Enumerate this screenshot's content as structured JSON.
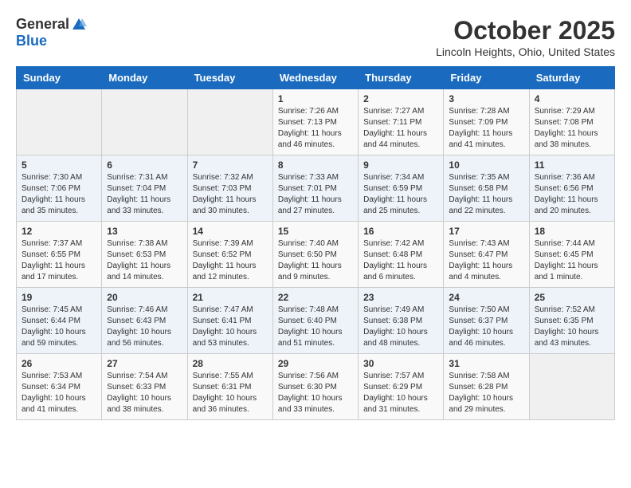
{
  "header": {
    "logo_general": "General",
    "logo_blue": "Blue",
    "month_title": "October 2025",
    "location": "Lincoln Heights, Ohio, United States"
  },
  "days_of_week": [
    "Sunday",
    "Monday",
    "Tuesday",
    "Wednesday",
    "Thursday",
    "Friday",
    "Saturday"
  ],
  "weeks": [
    [
      {
        "day": "",
        "info": ""
      },
      {
        "day": "",
        "info": ""
      },
      {
        "day": "",
        "info": ""
      },
      {
        "day": "1",
        "info": "Sunrise: 7:26 AM\nSunset: 7:13 PM\nDaylight: 11 hours and 46 minutes."
      },
      {
        "day": "2",
        "info": "Sunrise: 7:27 AM\nSunset: 7:11 PM\nDaylight: 11 hours and 44 minutes."
      },
      {
        "day": "3",
        "info": "Sunrise: 7:28 AM\nSunset: 7:09 PM\nDaylight: 11 hours and 41 minutes."
      },
      {
        "day": "4",
        "info": "Sunrise: 7:29 AM\nSunset: 7:08 PM\nDaylight: 11 hours and 38 minutes."
      }
    ],
    [
      {
        "day": "5",
        "info": "Sunrise: 7:30 AM\nSunset: 7:06 PM\nDaylight: 11 hours and 35 minutes."
      },
      {
        "day": "6",
        "info": "Sunrise: 7:31 AM\nSunset: 7:04 PM\nDaylight: 11 hours and 33 minutes."
      },
      {
        "day": "7",
        "info": "Sunrise: 7:32 AM\nSunset: 7:03 PM\nDaylight: 11 hours and 30 minutes."
      },
      {
        "day": "8",
        "info": "Sunrise: 7:33 AM\nSunset: 7:01 PM\nDaylight: 11 hours and 27 minutes."
      },
      {
        "day": "9",
        "info": "Sunrise: 7:34 AM\nSunset: 6:59 PM\nDaylight: 11 hours and 25 minutes."
      },
      {
        "day": "10",
        "info": "Sunrise: 7:35 AM\nSunset: 6:58 PM\nDaylight: 11 hours and 22 minutes."
      },
      {
        "day": "11",
        "info": "Sunrise: 7:36 AM\nSunset: 6:56 PM\nDaylight: 11 hours and 20 minutes."
      }
    ],
    [
      {
        "day": "12",
        "info": "Sunrise: 7:37 AM\nSunset: 6:55 PM\nDaylight: 11 hours and 17 minutes."
      },
      {
        "day": "13",
        "info": "Sunrise: 7:38 AM\nSunset: 6:53 PM\nDaylight: 11 hours and 14 minutes."
      },
      {
        "day": "14",
        "info": "Sunrise: 7:39 AM\nSunset: 6:52 PM\nDaylight: 11 hours and 12 minutes."
      },
      {
        "day": "15",
        "info": "Sunrise: 7:40 AM\nSunset: 6:50 PM\nDaylight: 11 hours and 9 minutes."
      },
      {
        "day": "16",
        "info": "Sunrise: 7:42 AM\nSunset: 6:48 PM\nDaylight: 11 hours and 6 minutes."
      },
      {
        "day": "17",
        "info": "Sunrise: 7:43 AM\nSunset: 6:47 PM\nDaylight: 11 hours and 4 minutes."
      },
      {
        "day": "18",
        "info": "Sunrise: 7:44 AM\nSunset: 6:45 PM\nDaylight: 11 hours and 1 minute."
      }
    ],
    [
      {
        "day": "19",
        "info": "Sunrise: 7:45 AM\nSunset: 6:44 PM\nDaylight: 10 hours and 59 minutes."
      },
      {
        "day": "20",
        "info": "Sunrise: 7:46 AM\nSunset: 6:43 PM\nDaylight: 10 hours and 56 minutes."
      },
      {
        "day": "21",
        "info": "Sunrise: 7:47 AM\nSunset: 6:41 PM\nDaylight: 10 hours and 53 minutes."
      },
      {
        "day": "22",
        "info": "Sunrise: 7:48 AM\nSunset: 6:40 PM\nDaylight: 10 hours and 51 minutes."
      },
      {
        "day": "23",
        "info": "Sunrise: 7:49 AM\nSunset: 6:38 PM\nDaylight: 10 hours and 48 minutes."
      },
      {
        "day": "24",
        "info": "Sunrise: 7:50 AM\nSunset: 6:37 PM\nDaylight: 10 hours and 46 minutes."
      },
      {
        "day": "25",
        "info": "Sunrise: 7:52 AM\nSunset: 6:35 PM\nDaylight: 10 hours and 43 minutes."
      }
    ],
    [
      {
        "day": "26",
        "info": "Sunrise: 7:53 AM\nSunset: 6:34 PM\nDaylight: 10 hours and 41 minutes."
      },
      {
        "day": "27",
        "info": "Sunrise: 7:54 AM\nSunset: 6:33 PM\nDaylight: 10 hours and 38 minutes."
      },
      {
        "day": "28",
        "info": "Sunrise: 7:55 AM\nSunset: 6:31 PM\nDaylight: 10 hours and 36 minutes."
      },
      {
        "day": "29",
        "info": "Sunrise: 7:56 AM\nSunset: 6:30 PM\nDaylight: 10 hours and 33 minutes."
      },
      {
        "day": "30",
        "info": "Sunrise: 7:57 AM\nSunset: 6:29 PM\nDaylight: 10 hours and 31 minutes."
      },
      {
        "day": "31",
        "info": "Sunrise: 7:58 AM\nSunset: 6:28 PM\nDaylight: 10 hours and 29 minutes."
      },
      {
        "day": "",
        "info": ""
      }
    ]
  ]
}
